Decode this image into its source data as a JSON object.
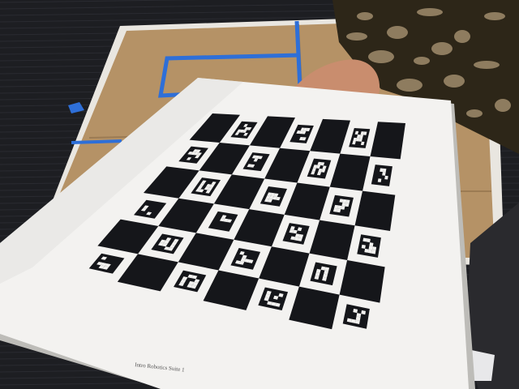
{
  "scene": {
    "subject": "Printed ChArUco calibration board held by a hand over a cardboard floor mat",
    "colors": {
      "carpet": "#1d1e22",
      "carpet_texture": "#2a2b31",
      "cardboard": "#b59266",
      "cardboard_shadow": "#9c7b53",
      "mat_border": "#e9e6e0",
      "blue_tape": "#2e6fd8",
      "paper": "#f3f2f0",
      "paper_shadow": "#d9d8d5",
      "square": "#15161a",
      "skin": "#c98d6e",
      "sleeve_dark": "#2d2618",
      "sleeve_light": "#a08c6c"
    }
  },
  "board": {
    "caption": "Intro Robotics Suite 1",
    "grid_rows": 6,
    "grid_cols": 7
  }
}
